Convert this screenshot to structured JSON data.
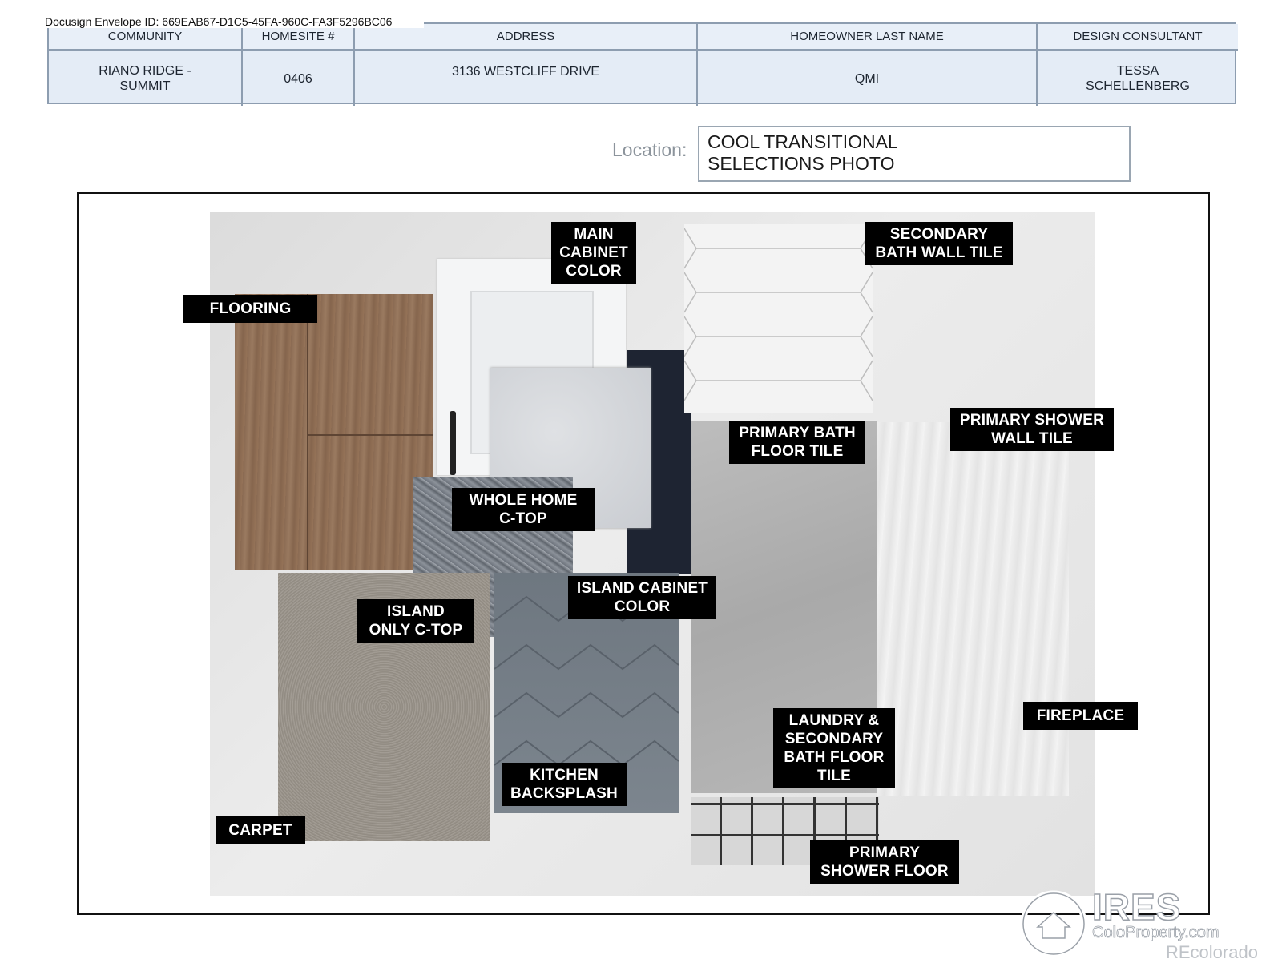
{
  "envelope_id": "Docusign Envelope ID: 669EAB67-D1C5-45FA-960C-FA3F5296BC06",
  "table": {
    "headers": [
      "COMMUNITY",
      "HOMESITE #",
      "ADDRESS",
      "HOMEOWNER LAST NAME",
      "DESIGN CONSULTANT"
    ],
    "values": [
      "RIANO RIDGE - SUMMIT",
      "0406",
      "3136 WESTCLIFF DRIVE",
      "QMI",
      "TESSA SCHELLENBERG"
    ]
  },
  "location": {
    "label": "Location:",
    "line1": "COOL TRANSITIONAL",
    "line2": "SELECTIONS PHOTO"
  },
  "labels": {
    "main_cabinet": [
      "MAIN",
      "CABINET",
      "COLOR"
    ],
    "secondary_bath_wall": [
      "SECONDARY",
      "BATH WALL TILE"
    ],
    "flooring": [
      "FLOORING"
    ],
    "primary_bath_floor": [
      "PRIMARY BATH",
      "FLOOR TILE"
    ],
    "primary_shower_wall": [
      "PRIMARY SHOWER",
      "WALL TILE"
    ],
    "whole_home_ctop": [
      "WHOLE HOME",
      "C-TOP"
    ],
    "island_cabinet": [
      "ISLAND CABINET",
      "COLOR"
    ],
    "island_ctop": [
      "ISLAND",
      "ONLY C-TOP"
    ],
    "fireplace": [
      "FIREPLACE"
    ],
    "laundry": [
      "LAUNDRY &",
      "SECONDARY",
      "BATH FLOOR",
      "TILE"
    ],
    "kitchen_backsplash": [
      "KITCHEN",
      "BACKSPLASH"
    ],
    "carpet": [
      "CARPET"
    ],
    "primary_shower_floor": [
      "PRIMARY",
      "SHOWER FLOOR"
    ]
  },
  "watermark": {
    "brand": "IRES",
    "site": "ColoProperty.com",
    "source": "REcolorado"
  }
}
